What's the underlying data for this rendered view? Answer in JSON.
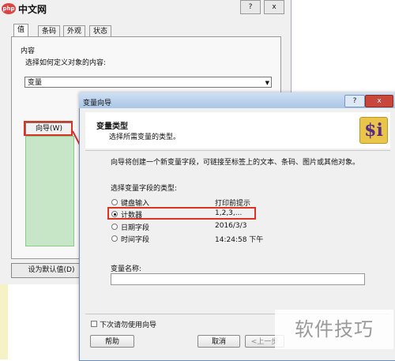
{
  "logo": {
    "badge": "php",
    "text": "中文网"
  },
  "bg_window": {
    "help_btn": "?",
    "close_btn": "x",
    "tabs": [
      "值",
      "条码",
      "外观",
      "状态"
    ],
    "section": "内容",
    "prompt": "选择如何定义对象的内容:",
    "select_value": "变量",
    "wizard_button": "向导(W)",
    "default_button": "设为默认值(D)"
  },
  "dialog": {
    "title": "变量向导",
    "header_title": "变量类型",
    "header_subtitle": "选择所需变量的类型。",
    "logo": "$i",
    "description": "向导将创建一个新变量字段，可链接至标签上的文本、条码、图片或其他对象。",
    "type_label": "选择变量字段的类型:",
    "options": [
      {
        "label": "键盘输入",
        "example": "打印前提示",
        "selected": false
      },
      {
        "label": "计数器",
        "example": "1,2,3,...",
        "selected": true
      },
      {
        "label": "日期字段",
        "example": "2016/3/3",
        "selected": false
      },
      {
        "label": "时间字段",
        "example": "14:24:58 下午",
        "selected": false
      }
    ],
    "name_label": "变量名称:",
    "checkbox_label": "下次请勿使用向导",
    "help_button": "帮助",
    "cancel_button": "取消",
    "back_button": "<上一步",
    "help_title_btn": "?",
    "close_title_btn": "x"
  },
  "watermark": "软件技巧",
  "colors": {
    "annotation": "#d32f2f",
    "title_bar": "#a9c5e6",
    "preview": "#c7e5c7"
  }
}
